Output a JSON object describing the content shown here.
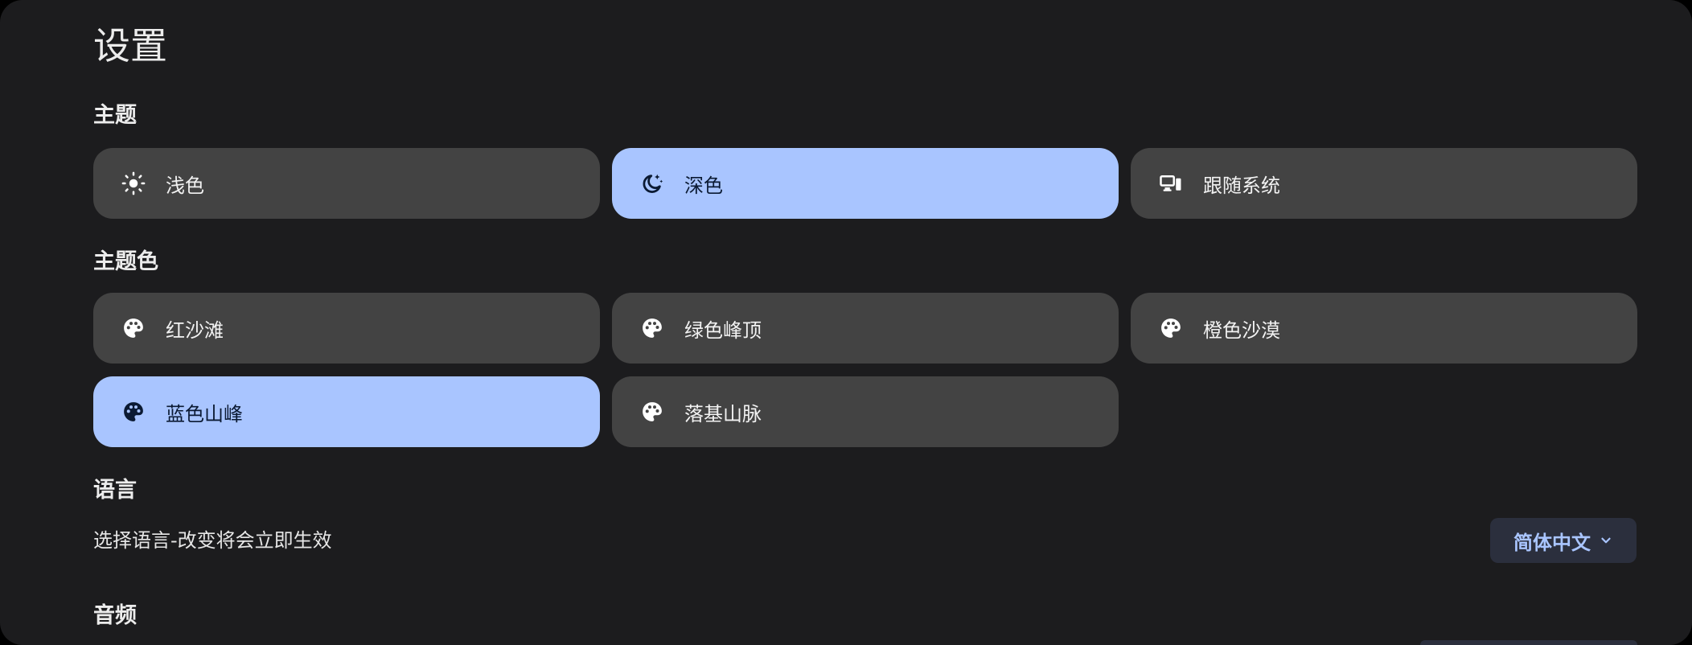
{
  "page": {
    "title": "设置"
  },
  "theme": {
    "section_title": "主题",
    "options": [
      {
        "label": "浅色",
        "icon": "sun-icon",
        "selected": false
      },
      {
        "label": "深色",
        "icon": "moon-stars-icon",
        "selected": true
      },
      {
        "label": "跟随系统",
        "icon": "devices-icon",
        "selected": false
      }
    ]
  },
  "theme_color": {
    "section_title": "主题色",
    "options": [
      {
        "label": "红沙滩",
        "icon": "palette-icon",
        "selected": false
      },
      {
        "label": "绿色峰顶",
        "icon": "palette-icon",
        "selected": false
      },
      {
        "label": "橙色沙漠",
        "icon": "palette-icon",
        "selected": false
      },
      {
        "label": "蓝色山峰",
        "icon": "palette-icon",
        "selected": true
      },
      {
        "label": "落基山脉",
        "icon": "palette-icon",
        "selected": false
      }
    ]
  },
  "language": {
    "section_title": "语言",
    "description": "选择语言-改变将会立即生效",
    "selected": "简体中文",
    "chevron_icon": "chevron-down-icon"
  },
  "audio": {
    "section_title": "音频"
  },
  "colors": {
    "background": "#1c1c1e",
    "option": "#434343",
    "selected": "#a9c5ff",
    "select_bg": "#2b2f3d",
    "accent_text": "#a9c5ff"
  }
}
